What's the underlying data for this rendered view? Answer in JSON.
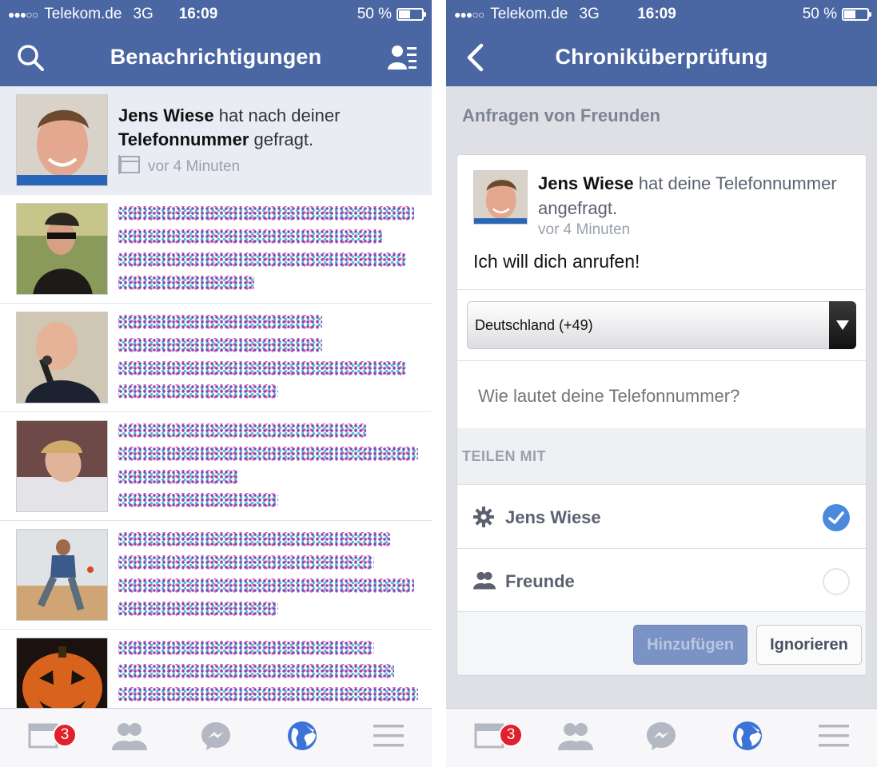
{
  "status_bar": {
    "signal": "●●●○○",
    "carrier": "Telekom.de",
    "network": "3G",
    "time": "16:09",
    "battery_text": "50 %",
    "battery_level": 0.5
  },
  "left_screen": {
    "nav_title": "Benachrichtigungen",
    "icons": {
      "left": "search-icon",
      "right": "friend-requests-icon"
    },
    "first_notification": {
      "name": "Jens Wiese",
      "text_part1": " hat nach deiner",
      "bold_part": "Telefonnummer",
      "text_part2": " gefragt.",
      "time": "vor 4 Minuten",
      "highlighted": true
    },
    "blurred_notification_count": 5
  },
  "right_screen": {
    "nav_title": "Chroniküberprüfung",
    "icons": {
      "left": "back-chevron-icon"
    },
    "section_title": "Anfragen von Freunden",
    "request": {
      "name": "Jens Wiese",
      "text": " hat deine Telefonnummer angefragt.",
      "time": "vor 4 Minuten",
      "message": "Ich will dich anrufen!"
    },
    "country_select": "Deutschland (+49)",
    "phone_placeholder": "Wie lautet deine Telefonnummer?",
    "share_header": "TEILEN MIT",
    "share_options": [
      {
        "label": "Jens Wiese",
        "icon": "gear-icon",
        "selected": true
      },
      {
        "label": "Freunde",
        "icon": "friends-icon",
        "selected": false
      }
    ],
    "buttons": {
      "add": "Hinzufügen",
      "ignore": "Ignorieren"
    }
  },
  "tab_bar": {
    "tabs": [
      "news-feed-icon",
      "friend-requests-icon",
      "messenger-icon",
      "notifications-globe-icon",
      "menu-icon"
    ],
    "badge": "3",
    "active_tab": 3,
    "colors": {
      "active": "#3b73d8",
      "inactive": "#b4b8c2"
    }
  },
  "colors": {
    "nav": "#4a67a3",
    "badge": "#e0212b",
    "check": "#4a89dc"
  }
}
